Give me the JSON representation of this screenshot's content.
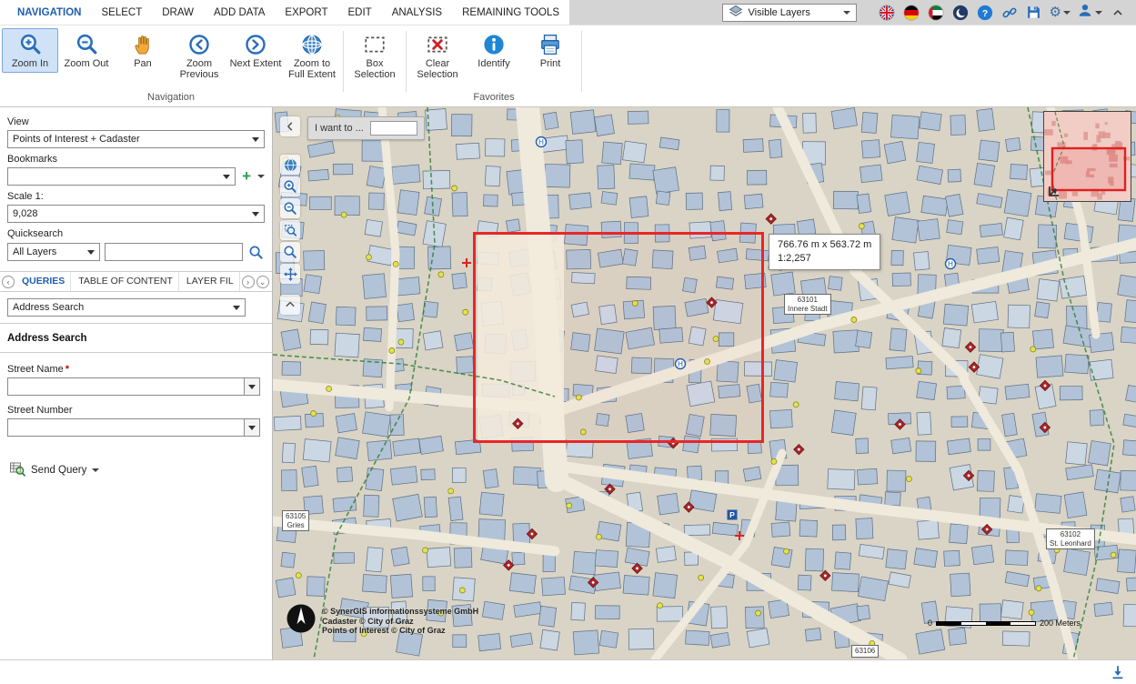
{
  "menubar": {
    "tabs": [
      "NAVIGATION",
      "SELECT",
      "DRAW",
      "ADD DATA",
      "EXPORT",
      "EDIT",
      "ANALYSIS",
      "REMAINING TOOLS"
    ],
    "active_tab": "NAVIGATION",
    "visible_layers_label": "Visible Layers"
  },
  "ribbon": {
    "groups": [
      {
        "label": "Navigation",
        "tools": [
          {
            "label": "Zoom In",
            "icon": "zoom-in-icon",
            "active": true
          },
          {
            "label": "Zoom Out",
            "icon": "zoom-out-icon",
            "active": false
          },
          {
            "label": "Pan",
            "icon": "pan-hand-icon",
            "active": false
          },
          {
            "label": "Zoom Previous",
            "icon": "zoom-previous-icon",
            "active": false
          },
          {
            "label": "Next Extent",
            "icon": "next-extent-icon",
            "active": false
          },
          {
            "label": "Zoom to Full Extent",
            "icon": "globe-icon",
            "active": false
          }
        ]
      },
      {
        "label": "",
        "tools": [
          {
            "label": "Box Selection",
            "icon": "box-selection-icon",
            "active": false
          }
        ]
      },
      {
        "label": "Favorites",
        "tools": [
          {
            "label": "Clear Selection",
            "icon": "clear-selection-icon",
            "active": false
          },
          {
            "label": "Identify",
            "icon": "identify-icon",
            "active": false
          },
          {
            "label": "Print",
            "icon": "print-icon",
            "active": false
          }
        ]
      }
    ]
  },
  "panel": {
    "view_label": "View",
    "view_value": "Points of Interest + Cadaster",
    "bookmarks_label": "Bookmarks",
    "bookmarks_value": "",
    "scale_label": "Scale 1:",
    "scale_value": "9,028",
    "quicksearch_label": "Quicksearch",
    "quicksearch_layer": "All Layers",
    "quicksearch_value": "",
    "tabs": [
      "QUERIES",
      "TABLE OF CONTENT",
      "LAYER FIL"
    ],
    "active_tab": "QUERIES",
    "query_select_value": "Address Search",
    "section_title": "Address Search",
    "street_name_label": "Street Name",
    "required_mark": "*",
    "street_number_label": "Street Number",
    "street_name_value": "",
    "street_number_value": "",
    "send_query_label": "Send Query"
  },
  "map": {
    "i_want_to_label": "I want to ...",
    "i_want_to_value": "",
    "measure_tooltip": {
      "dimensions": "766.76 m x 563.72 m",
      "scale": "1:2,257"
    },
    "district_labels": [
      {
        "code": "63101",
        "name": "Innere Stadt"
      },
      {
        "code": "63105",
        "name": "Gries"
      },
      {
        "code": "63102",
        "name": "St. Leonhard"
      },
      {
        "code": "63106",
        "name": ""
      }
    ],
    "copyright_lines": [
      "© SynerGIS informationssysteme GmbH",
      "Cadaster © City of Graz",
      "Points of Interest © City of Graz"
    ],
    "scalebar": {
      "zero_label": "0",
      "distance_label": "200 Meters"
    }
  },
  "icons": {
    "topbar": [
      "layers-icon",
      "uk-flag-icon",
      "germany-flag-icon",
      "uae-flag-icon",
      "dark-mode-icon",
      "help-icon",
      "link-icon",
      "save-icon",
      "settings-gear-icon",
      "user-account-icon",
      "collapse-ribbon-icon"
    ],
    "map_toolbar": [
      "collapse-panel-icon",
      "globe-icon",
      "zoom-in-icon",
      "zoom-out-icon",
      "zoom-window-icon",
      "zoom-extent-icon",
      "pan-move-icon",
      "scroll-up-icon"
    ],
    "bottom": [
      "download-icon"
    ]
  },
  "colors": {
    "accent_blue": "#1d5fae",
    "selection_red": "#e8262a",
    "map_background": "#d9d4c5",
    "building_fill": "#b2c3d8",
    "boundary_green": "#2e7d32"
  }
}
